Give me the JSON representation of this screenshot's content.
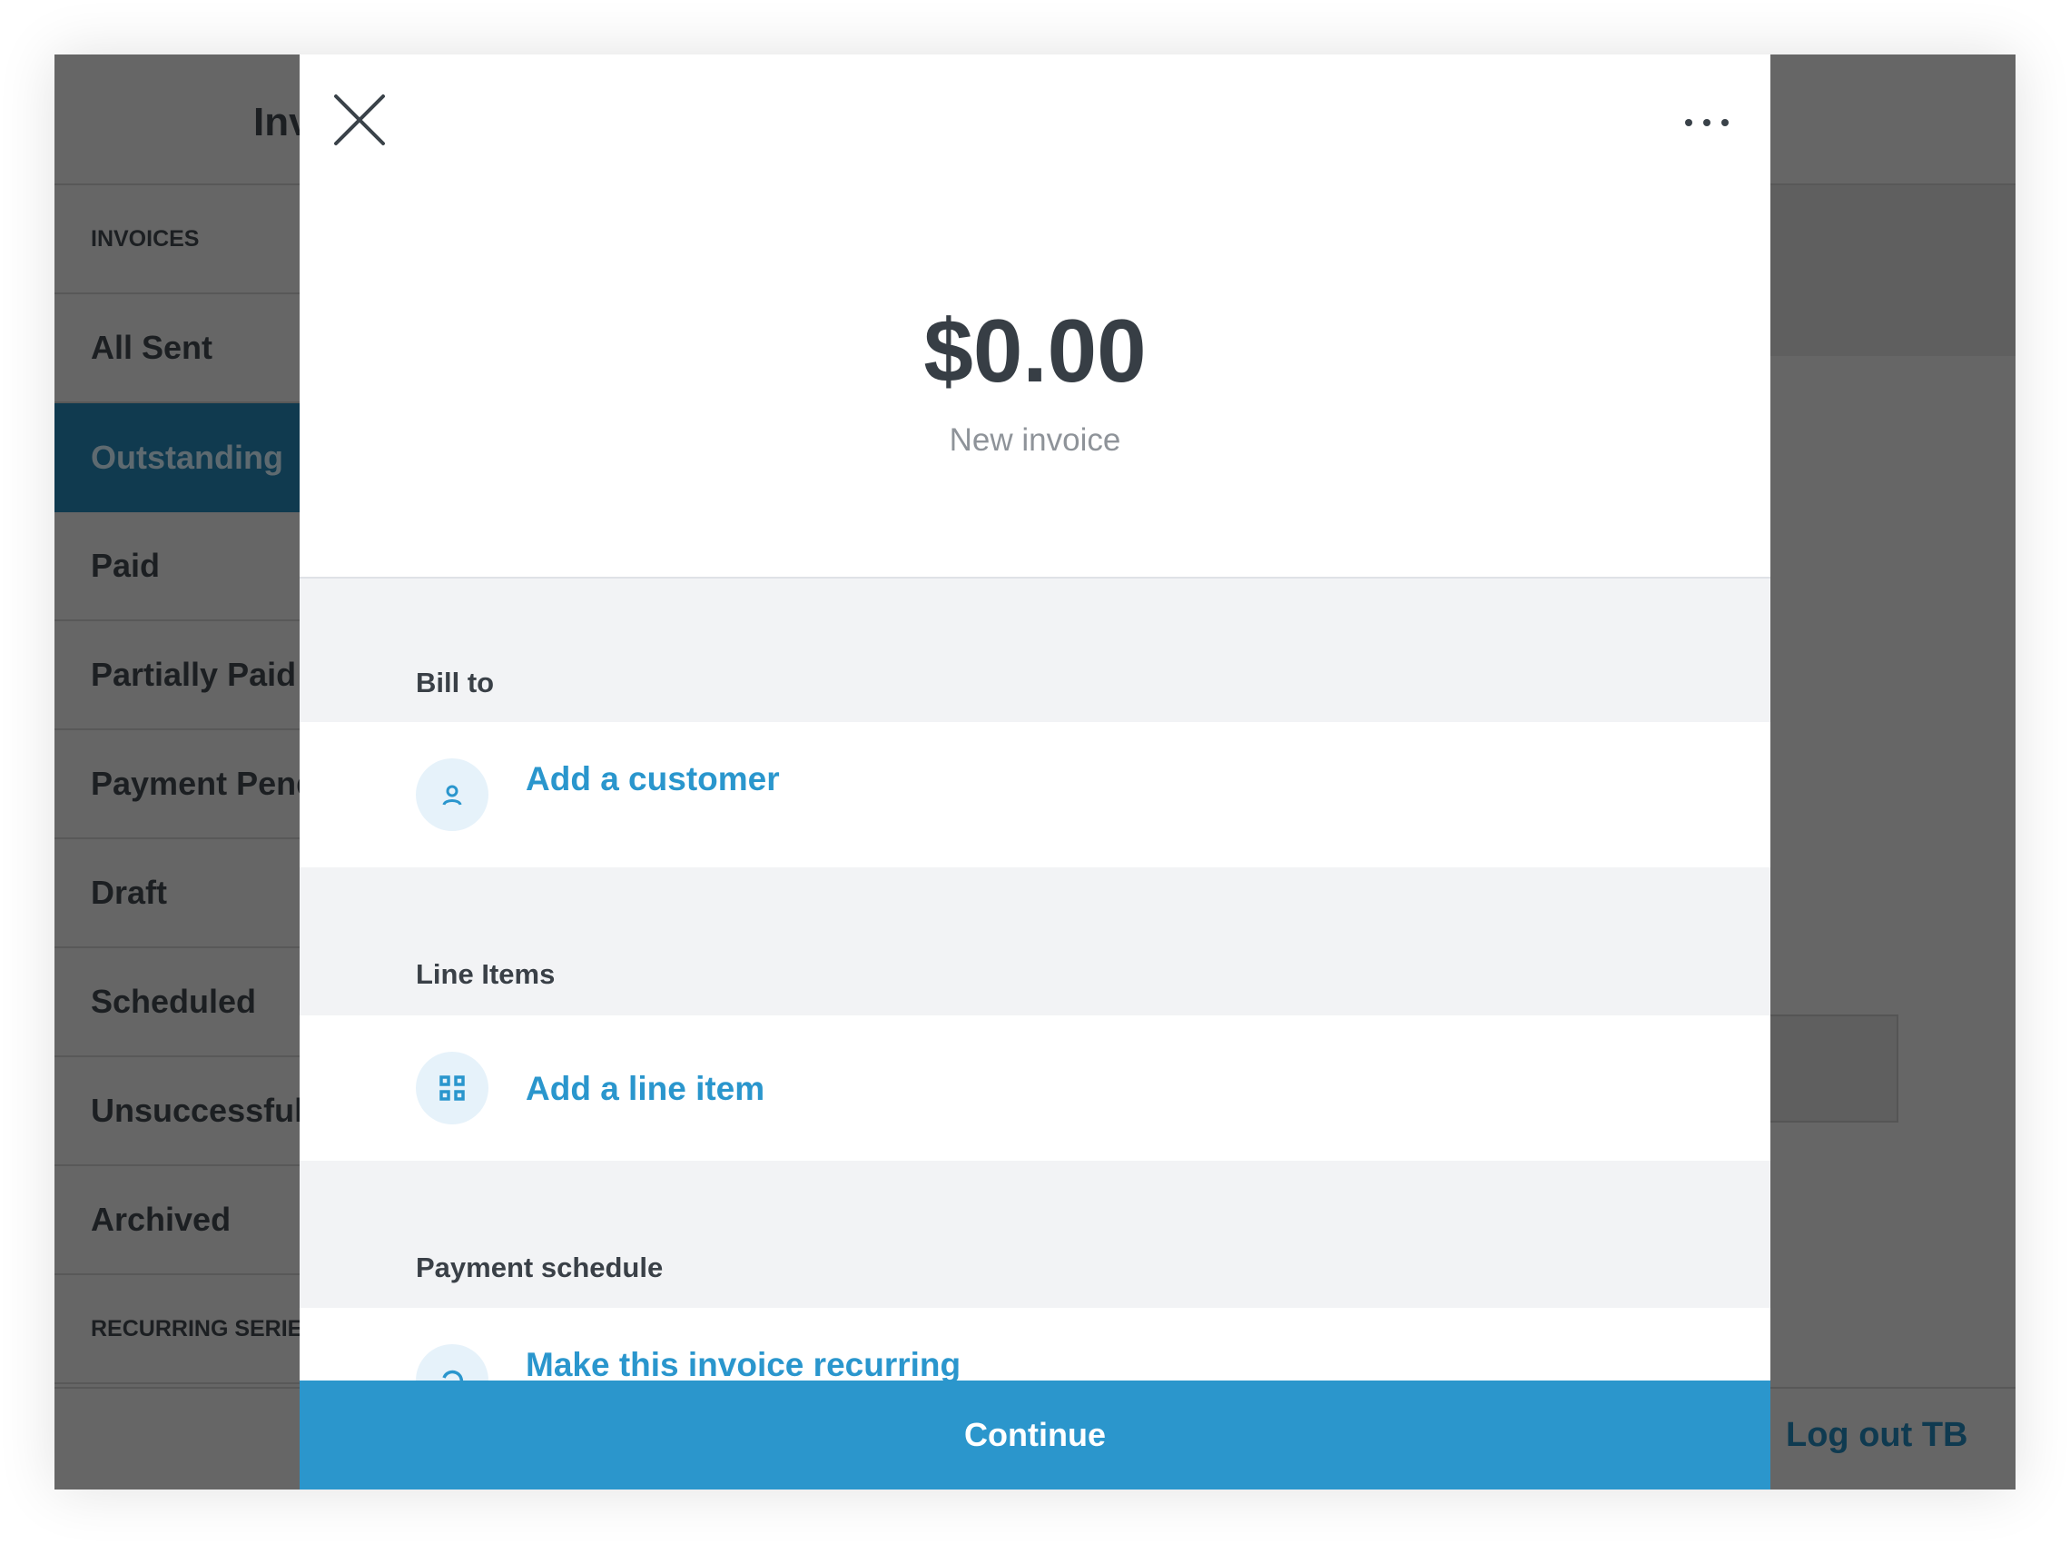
{
  "background": {
    "header_title": "Inv",
    "sidebar": {
      "section_invoices": "INVOICES",
      "items": [
        {
          "label": "All Sent"
        },
        {
          "label": "Outstanding",
          "active": true
        },
        {
          "label": "Paid"
        },
        {
          "label": "Partially Paid"
        },
        {
          "label": "Payment Pending"
        },
        {
          "label": "Draft"
        },
        {
          "label": "Scheduled"
        },
        {
          "label": "Unsuccessful"
        },
        {
          "label": "Archived"
        }
      ],
      "section_recurring": "RECURRING SERIES"
    },
    "logout_label": "Log out TB"
  },
  "modal": {
    "amount": "$0.00",
    "subtitle": "New invoice",
    "bill_to": {
      "heading": "Bill to",
      "action": "Add a customer",
      "icon": "person-icon"
    },
    "line_items": {
      "heading": "Line Items",
      "action": "Add a line item",
      "icon": "grid-icon"
    },
    "payment_schedule": {
      "heading": "Payment schedule",
      "action": "Make this invoice recurring",
      "icon": "recurring-icon"
    },
    "continue_label": "Continue"
  },
  "colors": {
    "accent": "#2b96cc",
    "link": "#2a96cd",
    "active_nav": "#103a4f",
    "overlay": "#666666"
  }
}
